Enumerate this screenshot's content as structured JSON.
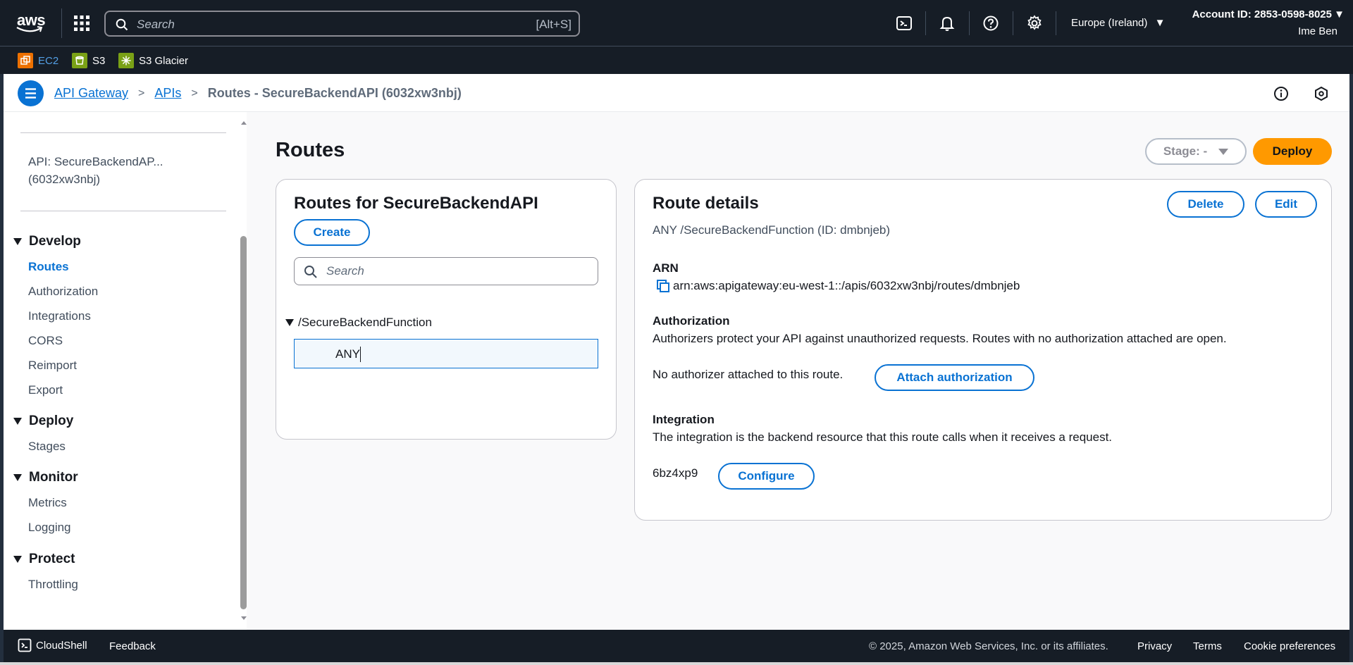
{
  "topnav": {
    "logo_text": "aws",
    "search_placeholder": "Search",
    "search_shortcut": "[Alt+S]",
    "region": "Europe (Ireland)",
    "account": "Account ID: 2853-0598-8025",
    "user": "Ime Ben",
    "icons": [
      "cloudshell-icon",
      "bell-icon",
      "help-icon",
      "gear-icon"
    ]
  },
  "favorites": [
    {
      "label": "EC2",
      "color": "#ed7100"
    },
    {
      "label": "S3",
      "color": "#7aa116"
    },
    {
      "label": "S3 Glacier",
      "color": "#7aa116"
    }
  ],
  "breadcrumb": {
    "items": [
      "API Gateway",
      "APIs"
    ],
    "current": "Routes - SecureBackendAPI (6032xw3nbj)"
  },
  "sidebar": {
    "api_name": "API: SecureBackendAP...\n(6032xw3nbj)",
    "sections": [
      {
        "title": "Develop",
        "links": [
          "Routes",
          "Authorization",
          "Integrations",
          "CORS",
          "Reimport",
          "Export"
        ]
      },
      {
        "title": "Deploy",
        "links": [
          "Stages"
        ]
      },
      {
        "title": "Monitor",
        "links": [
          "Metrics",
          "Logging"
        ]
      },
      {
        "title": "Protect",
        "links": [
          "Throttling"
        ]
      }
    ],
    "active": "Routes"
  },
  "main": {
    "title": "Routes",
    "stage_label": "Stage: -",
    "deploy_label": "Deploy"
  },
  "routes_panel": {
    "title": "Routes for SecureBackendAPI",
    "create_label": "Create",
    "search_placeholder": "Search",
    "resource": "/SecureBackendFunction",
    "method": "ANY"
  },
  "details": {
    "title": "Route details",
    "subtitle": "ANY /SecureBackendFunction (ID: dmbnjeb)",
    "delete_label": "Delete",
    "edit_label": "Edit",
    "arn_label": "ARN",
    "arn_value": "arn:aws:apigateway:eu-west-1::/apis/6032xw3nbj/routes/dmbnjeb",
    "auth_label": "Authorization",
    "auth_desc": "Authorizers protect your API against unauthorized requests. Routes with no authorization attached are open.",
    "auth_status": "No authorizer attached to this route.",
    "attach_label": "Attach authorization",
    "integration_label": "Integration",
    "integration_desc": "The integration is the backend resource that this route calls when it receives a request.",
    "integration_id": "6bz4xp9",
    "configure_label": "Configure"
  },
  "footer": {
    "cloudshell": "CloudShell",
    "feedback": "Feedback",
    "copyright": "© 2025, Amazon Web Services, Inc. or its affiliates.",
    "privacy": "Privacy",
    "terms": "Terms",
    "cookies": "Cookie preferences"
  },
  "colors": {
    "accent": "#0972d3",
    "deploy": "#ff9900",
    "nav_bg": "#161d26"
  }
}
